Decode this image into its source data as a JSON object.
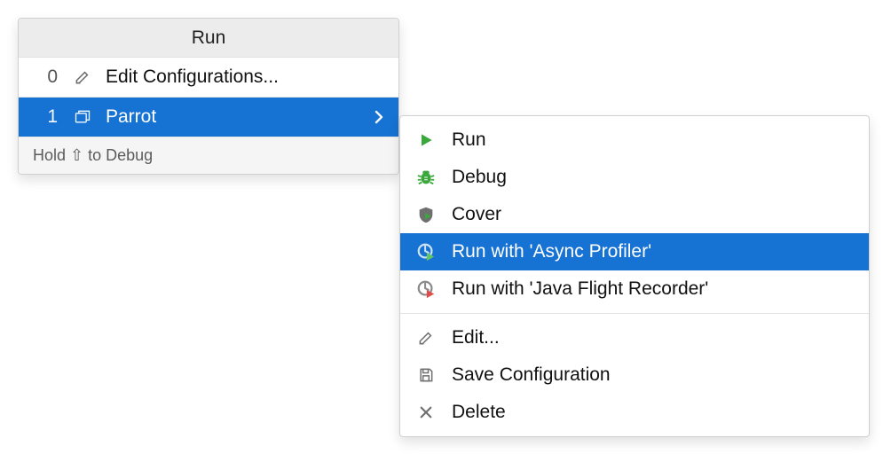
{
  "run_popup": {
    "title": "Run",
    "items": [
      {
        "num": "0",
        "label": "Edit Configurations..."
      },
      {
        "num": "1",
        "label": "Parrot"
      }
    ],
    "footer": "Hold ⇧ to Debug"
  },
  "submenu": {
    "items": [
      {
        "label": "Run"
      },
      {
        "label": "Debug"
      },
      {
        "label": "Cover"
      },
      {
        "label": "Run with 'Async Profiler'"
      },
      {
        "label": "Run with 'Java Flight Recorder'"
      }
    ],
    "items2": [
      {
        "label": "Edit..."
      },
      {
        "label": "Save Configuration"
      },
      {
        "label": "Delete"
      }
    ]
  }
}
